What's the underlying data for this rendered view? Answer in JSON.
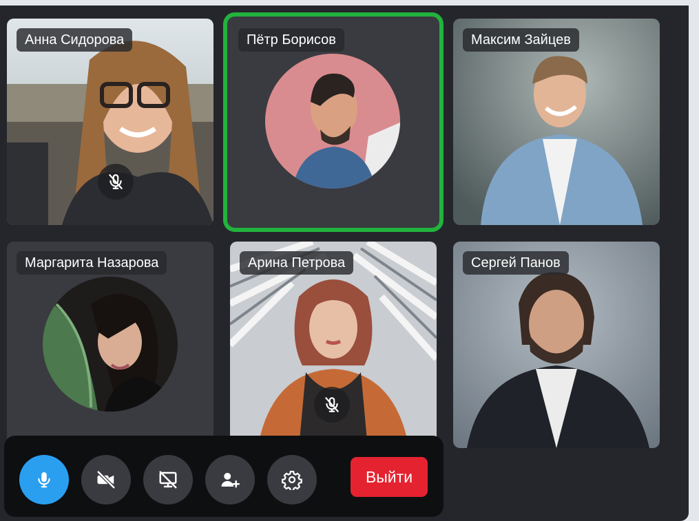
{
  "participants": [
    {
      "name": "Анна Сидорова",
      "video": true,
      "muted": true
    },
    {
      "name": "Пётр Борисов",
      "video": false,
      "muted": false,
      "speaking": true
    },
    {
      "name": "Максим Зайцев",
      "video": true,
      "muted": false
    },
    {
      "name": "Маргарита Назарова",
      "video": false,
      "muted": false
    },
    {
      "name": "Арина Петрова",
      "video": true,
      "muted": true
    },
    {
      "name": "Сергей Панов",
      "video": true,
      "muted": false
    }
  ],
  "controls": {
    "mic": {
      "icon": "microphone-icon",
      "active": true
    },
    "camera": {
      "icon": "camera-off-icon"
    },
    "screen": {
      "icon": "screen-share-off-icon"
    },
    "add_user": {
      "icon": "add-user-icon"
    },
    "settings": {
      "icon": "gear-icon"
    },
    "leave_label": "Выйти"
  },
  "colors": {
    "speaking_outline": "#22b33d",
    "mic_active": "#2a9ff0",
    "leave_button": "#e52330",
    "background": "#25262b",
    "tile": "#3a3b40"
  }
}
